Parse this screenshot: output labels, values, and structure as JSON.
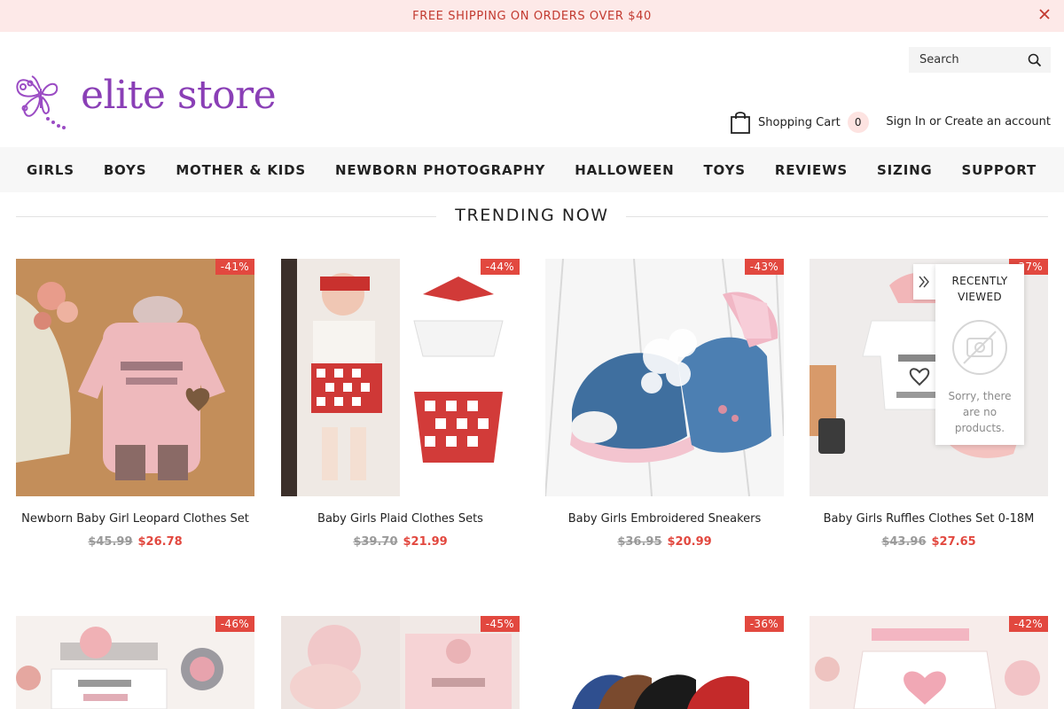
{
  "announcement": {
    "text": "FREE SHIPPING ON ORDERS OVER $40"
  },
  "header": {
    "search_placeholder": "Search",
    "logo_text": "elite store",
    "cart_label": "Shopping Cart",
    "cart_count": "0",
    "sign_in": "Sign In",
    "or": " or ",
    "create_account": "Create an account"
  },
  "nav": {
    "items": [
      "GIRLS",
      "BOYS",
      "MOTHER & KIDS",
      "NEWBORN PHOTOGRAPHY",
      "HALLOWEEN",
      "TOYS",
      "REVIEWS",
      "SIZING",
      "SUPPORT"
    ]
  },
  "section": {
    "title": "TRENDING NOW"
  },
  "products": [
    {
      "title": "Newborn Baby Girl Leopard Clothes Set",
      "old_price": "$45.99",
      "new_price": "$26.78",
      "badge": "-41%"
    },
    {
      "title": "Baby Girls Plaid Clothes Sets",
      "old_price": "$39.70",
      "new_price": "$21.99",
      "badge": "-44%"
    },
    {
      "title": "Baby Girls Embroidered Sneakers",
      "old_price": "$36.95",
      "new_price": "$20.99",
      "badge": "-43%"
    },
    {
      "title": "Baby Girls Ruffles Clothes Set 0-18M",
      "old_price": "$43.96",
      "new_price": "$27.65",
      "badge": "-37%"
    },
    {
      "badge": "-46%"
    },
    {
      "badge": "-45%"
    },
    {
      "badge": "-36%"
    },
    {
      "badge": "-42%"
    }
  ],
  "recently_viewed": {
    "title_line1": "RECENTLY",
    "title_line2": "VIEWED",
    "empty_line1": "Sorry, there",
    "empty_line2": "are no",
    "empty_line3": "products."
  },
  "colors": {
    "announce_bg": "#fde9e8",
    "announce_text": "#c2392f",
    "brand_purple": "#8a3fb6",
    "sale_red": "#e2483f",
    "nav_bg": "#f7f7f7"
  },
  "icons": {
    "close": "close-icon",
    "search": "search-icon",
    "cart": "shopping-bag-icon",
    "logo": "butterfly-icon",
    "recently_viewed_toggle": "double-chevron-right-icon",
    "empty": "no-image-icon"
  }
}
